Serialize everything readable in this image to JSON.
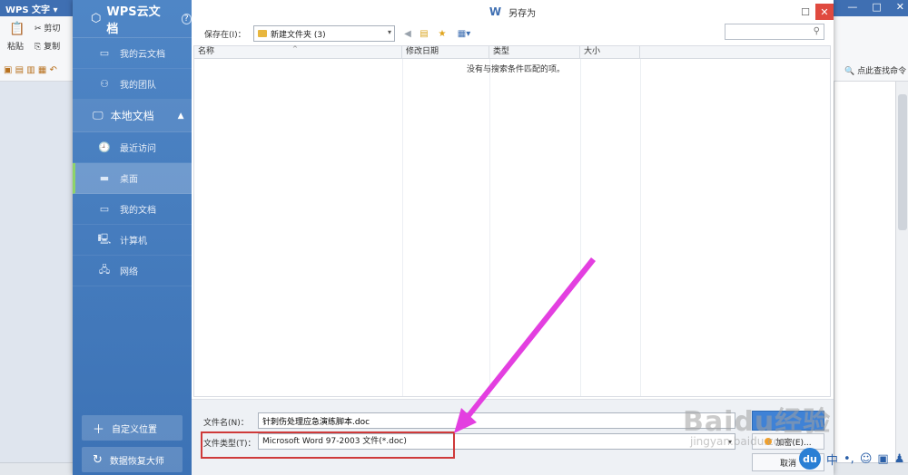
{
  "background_app": {
    "title": "WPS 文字",
    "toolbar": {
      "cut": "剪切",
      "paste": "粘贴",
      "copy": "复制"
    },
    "find_replace": "点此查找命令"
  },
  "sidebar": {
    "header": "WPS云文档",
    "help": "?",
    "cloud_items": [
      {
        "label": "我的云文档",
        "icon": "cloud-doc-icon"
      },
      {
        "label": "我的团队",
        "icon": "team-icon"
      }
    ],
    "local_section": "本地文档",
    "local_items": [
      {
        "label": "最近访问",
        "icon": "recent-icon"
      },
      {
        "label": "桌面",
        "icon": "desktop-icon",
        "selected": true
      },
      {
        "label": "我的文档",
        "icon": "folder-icon"
      },
      {
        "label": "计算机",
        "icon": "computer-icon"
      },
      {
        "label": "网络",
        "icon": "network-icon"
      }
    ],
    "custom_location": "自定义位置",
    "data_recovery": "数据恢复大师"
  },
  "dialog": {
    "title": "另存为",
    "logo": "W",
    "save_in_label": "保存在(I)：",
    "save_in_value": "新建文件夹 (3)",
    "columns": [
      "名称",
      "修改日期",
      "类型",
      "大小"
    ],
    "empty_message": "没有与搜索条件匹配的项。",
    "file_name_label": "文件名(N)：",
    "file_name_value": "针刺伤处理应急演练脚本.doc",
    "file_type_label": "文件类型(T)：",
    "file_type_value": "Microsoft Word 97-2003 文件(*.doc)",
    "encrypt_button": "加密(E)...",
    "cancel_button": "取消"
  },
  "watermark": {
    "brand": "Baidu经验",
    "url": "jingyan.baidu.com"
  },
  "tray": {
    "du": "du",
    "lang": "中"
  },
  "colors": {
    "sidebar": "#4a80c1",
    "highlight": "#cf3a3a",
    "arrow": "#e33fe0",
    "save_button": "#3f82d6"
  }
}
